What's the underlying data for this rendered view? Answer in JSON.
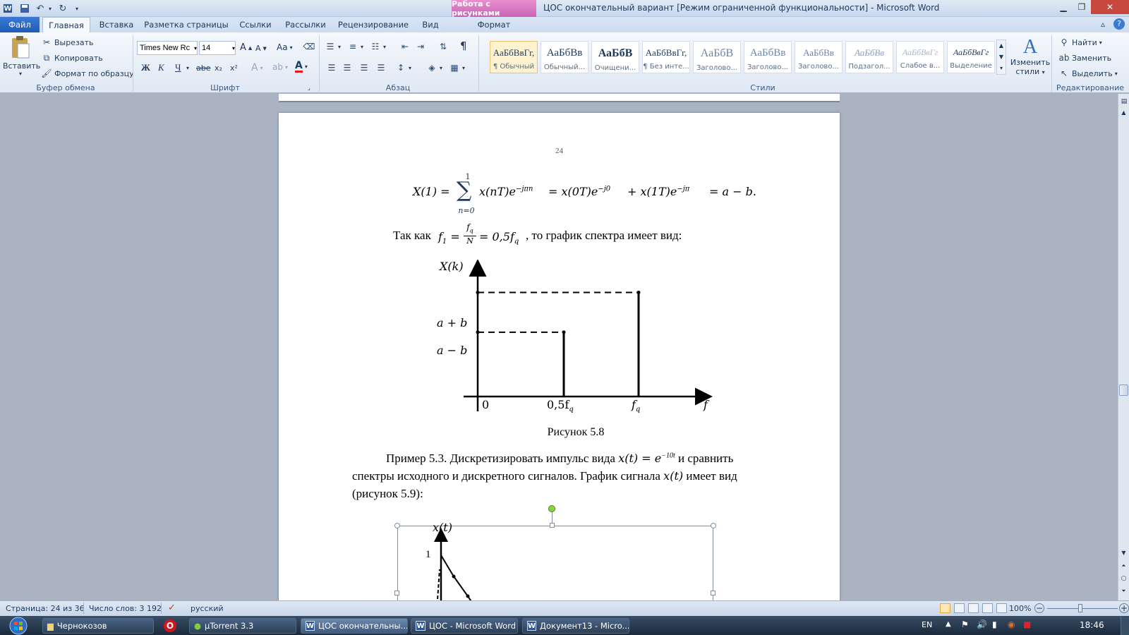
{
  "window": {
    "title": "ЦОС окончательный вариант [Режим ограниченной функциональности]  -  Microsoft Word",
    "context_tab": "Работа с рисунками",
    "context_subtab": "Формат"
  },
  "tabs": [
    "Файл",
    "Главная",
    "Вставка",
    "Разметка страницы",
    "Ссылки",
    "Рассылки",
    "Рецензирование",
    "Вид"
  ],
  "clipboard": {
    "paste": "Вставить",
    "cut": "Вырезать",
    "copy": "Копировать",
    "format_painter": "Формат по образцу",
    "label": "Буфер обмена"
  },
  "font": {
    "name": "Times New Rc",
    "size": "14",
    "label": "Шрифт",
    "bold": "Ж",
    "italic": "К",
    "underline": "Ч",
    "strike": "abe",
    "sub": "x₂",
    "sup": "x²",
    "grow": "A",
    "shrink": "A",
    "case": "Aa",
    "color": "A"
  },
  "paragraph": {
    "label": "Абзац",
    "pilcrow": "¶"
  },
  "styles": {
    "label": "Стили",
    "items": [
      {
        "sample": "АаБбВвГг,",
        "name": "¶ Обычный"
      },
      {
        "sample": "АаБбВв",
        "name": "Обычный..."
      },
      {
        "sample": "АаБбВ",
        "name": "Очищени..."
      },
      {
        "sample": "АаБбВвГг,",
        "name": "¶ Без инте..."
      },
      {
        "sample": "АаБбВ",
        "name": "Заголово..."
      },
      {
        "sample": "АаБбВв",
        "name": "Заголово..."
      },
      {
        "sample": "АаБбВв",
        "name": "Заголово..."
      },
      {
        "sample": "АаБбВв",
        "name": "Подзагол..."
      },
      {
        "sample": "АаБбВвГг",
        "name": "Слабое в..."
      },
      {
        "sample": "АаБбВвГг",
        "name": "Выделение"
      }
    ],
    "change_styles_line1": "Изменить",
    "change_styles_line2": "стили"
  },
  "editing": {
    "label": "Редактирование",
    "find": "Найти",
    "replace": "Заменить",
    "select": "Выделить"
  },
  "document": {
    "page_number": "24",
    "formula": "X(1) = ∑ x(nT)e",
    "formula_sum_top": "1",
    "formula_sum_bottom": "n=0",
    "formula_part1": "X(1) =",
    "formula_part2": "x(nT)e",
    "formula_exp1": "−jπn",
    "formula_part3": "= x(0T)e",
    "formula_exp2": "−j0",
    "formula_part4": "+ x(1T)e",
    "formula_exp3": "−jπ",
    "formula_part5": "= a − b.",
    "sentence_prefix": "Так как",
    "sentence_f1": "f",
    "sentence_f1_sub": "1",
    "sentence_eq": "=",
    "sentence_frac_num": "f",
    "sentence_frac_num_sub": "q",
    "sentence_frac_den": "N",
    "sentence_eq2": "= 0,5f",
    "sentence_eq2_sub": "q",
    "sentence_suffix": ", то график спектра имеет вид:",
    "figure_caption": "Рисунок 5.8",
    "para1_line1_a": "Пример 5.3. Дискретизировать импульс вида",
    "para1_line1_math": "x(t) = e",
    "para1_line1_exp": "−10t",
    "para1_line1_b": "и сравнить",
    "para1_line2_a": "спектры исходного и дискретного сигналов. График сигнала",
    "para1_line2_math": "x(t)",
    "para1_line2_b": "имеет вид",
    "para1_line3": "(рисунок 5.9):"
  },
  "chart_data": [
    {
      "type": "bar",
      "title": "",
      "ylabel": "X(k)",
      "xlabel": "f",
      "x_ticks": [
        "0",
        "0,5f_q",
        "f_q"
      ],
      "y_ticks": [
        "a − b",
        "a + b"
      ],
      "categories": [
        "0,5f_q",
        "f_q"
      ],
      "values": [
        "a − b",
        "a + b"
      ],
      "value_levels": [
        0.47,
        0.76
      ]
    },
    {
      "type": "line",
      "ylabel": "x(t)",
      "y_ticks": [
        "1"
      ],
      "note": ""
    }
  ],
  "chart1_labels": {
    "ylabel": "X(k)",
    "tick_ab_plus": "a + b",
    "tick_ab_minus": "a − b",
    "x0": "0",
    "x05": "0,5f",
    "x05_sub": "q",
    "xf": "f",
    "xf_sub": "q",
    "xaxis": "f"
  },
  "chart2_labels": {
    "ylabel": "x(t)",
    "y1": "1"
  },
  "status": {
    "page": "Страница: 24 из 36",
    "words": "Число слов: 3 192",
    "lang": "русский",
    "zoom": "100%"
  },
  "taskbar": {
    "items": [
      "Чернокозов",
      "µTorrent 3.3",
      "ЦОС окончательны...",
      "ЦОС - Microsoft Word",
      "Документ13 - Micro..."
    ],
    "lang": "EN",
    "clock": "18:46"
  }
}
